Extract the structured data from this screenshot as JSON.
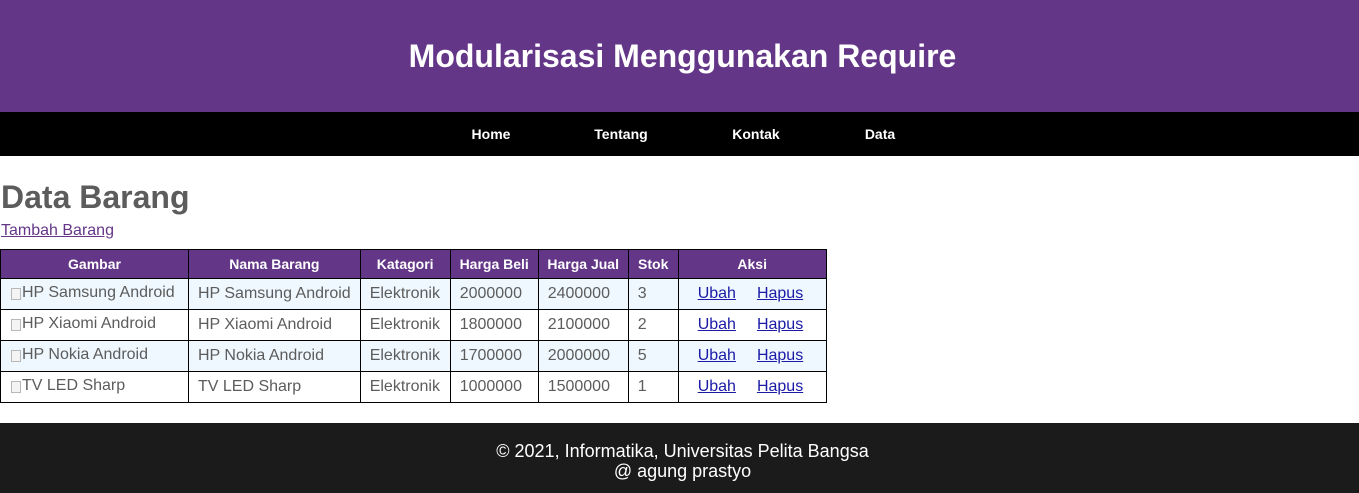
{
  "header": {
    "title": "Modularisasi Menggunakan Require"
  },
  "nav": {
    "items": [
      {
        "label": "Home"
      },
      {
        "label": "Tentang"
      },
      {
        "label": "Kontak"
      },
      {
        "label": "Data"
      }
    ]
  },
  "main": {
    "title": "Data Barang",
    "add_link": "Tambah Barang",
    "table": {
      "headers": [
        "Gambar",
        "Nama Barang",
        "Katagori",
        "Harga Beli",
        "Harga Jual",
        "Stok",
        "Aksi"
      ],
      "rows": [
        {
          "image_alt": "HP Samsung Android",
          "nama": "HP Samsung Android",
          "kategori": "Elektronik",
          "harga_beli": "2000000",
          "harga_jual": "2400000",
          "stok": "3",
          "ubah": "Ubah",
          "hapus": "Hapus"
        },
        {
          "image_alt": "HP Xiaomi Android",
          "nama": "HP Xiaomi Android",
          "kategori": "Elektronik",
          "harga_beli": "1800000",
          "harga_jual": "2100000",
          "stok": "2",
          "ubah": "Ubah",
          "hapus": "Hapus"
        },
        {
          "image_alt": "HP Nokia Android",
          "nama": "HP Nokia Android",
          "kategori": "Elektronik",
          "harga_beli": "1700000",
          "harga_jual": "2000000",
          "stok": "5",
          "ubah": "Ubah",
          "hapus": "Hapus"
        },
        {
          "image_alt": "TV LED Sharp",
          "nama": "TV LED Sharp",
          "kategori": "Elektronik",
          "harga_beli": "1000000",
          "harga_jual": "1500000",
          "stok": "1",
          "ubah": "Ubah",
          "hapus": "Hapus"
        }
      ]
    }
  },
  "footer": {
    "line1": "© 2021, Informatika, Universitas Pelita Bangsa",
    "line2": "@ agung prastyo"
  },
  "colors": {
    "header_bg": "#643688",
    "nav_bg": "#000000",
    "footer_bg": "#1b1b1b",
    "row_alt_bg": "#eff8fe",
    "link": "#1a1aa6"
  }
}
